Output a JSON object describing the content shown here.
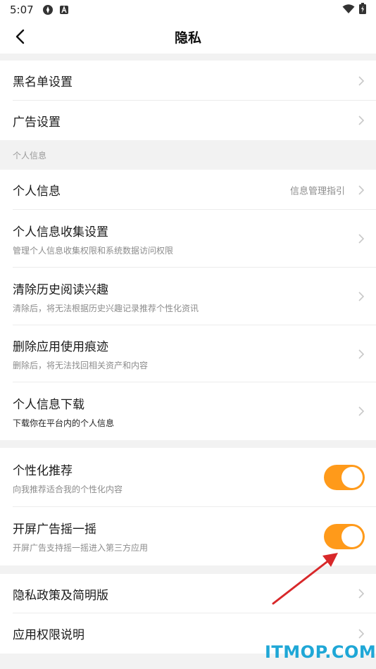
{
  "status": {
    "time": "5:07"
  },
  "header": {
    "title": "隐私"
  },
  "group1": [
    {
      "title": "黑名单设置"
    },
    {
      "title": "广告设置"
    }
  ],
  "section_personal": {
    "label": "个人信息"
  },
  "group2": [
    {
      "title": "个人信息",
      "value": "信息管理指引"
    },
    {
      "title": "个人信息收集设置",
      "sub": "管理个人信息收集权限和系统数据访问权限"
    },
    {
      "title": "清除历史阅读兴趣",
      "sub": "清除后，将无法根据历史兴趣记录推荐个性化资讯"
    },
    {
      "title": "删除应用使用痕迹",
      "sub": "删除后，将无法找回相关资产和内容"
    },
    {
      "title": "个人信息下载",
      "sub": "下载你在平台内的个人信息"
    }
  ],
  "group3": [
    {
      "title": "个性化推荐",
      "sub": "向我推荐适合我的个性化内容",
      "toggle_on": true
    },
    {
      "title": "开屏广告摇一摇",
      "sub": "开屏广告支持摇一摇进入第三方应用",
      "toggle_on": true
    }
  ],
  "group4": [
    {
      "title": "隐私政策及简明版"
    },
    {
      "title": "应用权限说明"
    }
  ],
  "watermark": "ITMOP.COM",
  "colors": {
    "accent": "#ff9a1a",
    "arrow": "#d8282a",
    "watermark": "#1fa7d6"
  }
}
